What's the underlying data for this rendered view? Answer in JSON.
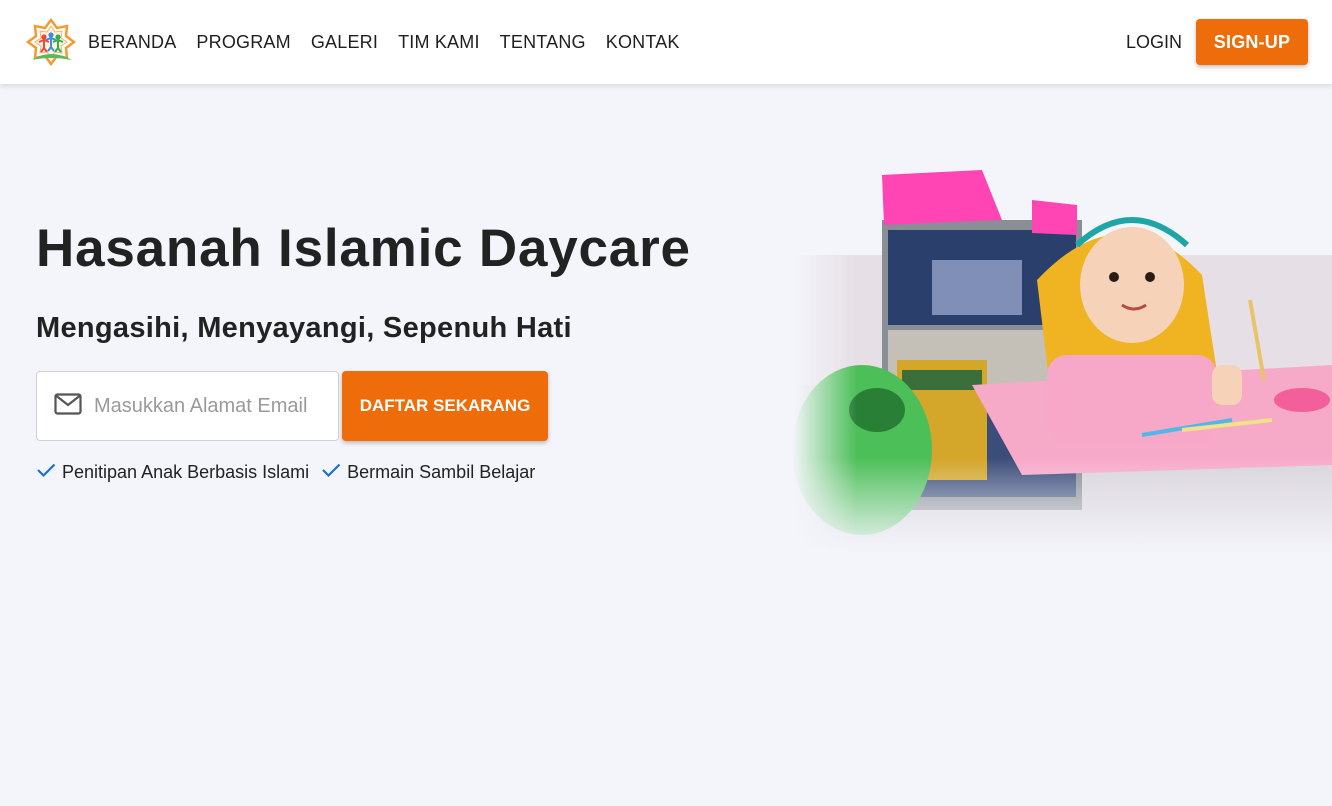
{
  "nav": {
    "logo": "logo-icon",
    "links": [
      "BERANDA",
      "PROGRAM",
      "GALERI",
      "TIM KAMI",
      "TENTANG",
      "KONTAK"
    ],
    "login_label": "LOGIN",
    "signup_label": "SIGN-UP"
  },
  "hero": {
    "title": "Hasanah Islamic Daycare",
    "subtitle": "Mengasihi, Menyayangi, Sepenuh Hati",
    "email_placeholder": "Masukkan Alamat Email",
    "email_value": "",
    "email_icon": "mail-icon",
    "cta_label": "DAFTAR SEKARANG",
    "features": [
      {
        "icon": "check-icon",
        "label": "Penitipan Anak Berbasis Islami"
      },
      {
        "icon": "check-icon",
        "label": "Bermain Sambil Belajar"
      }
    ]
  },
  "colors": {
    "accent": "#ee6c0a",
    "check": "#1a73c8",
    "background": "#f4f5fa",
    "navbar": "#ffffff"
  }
}
